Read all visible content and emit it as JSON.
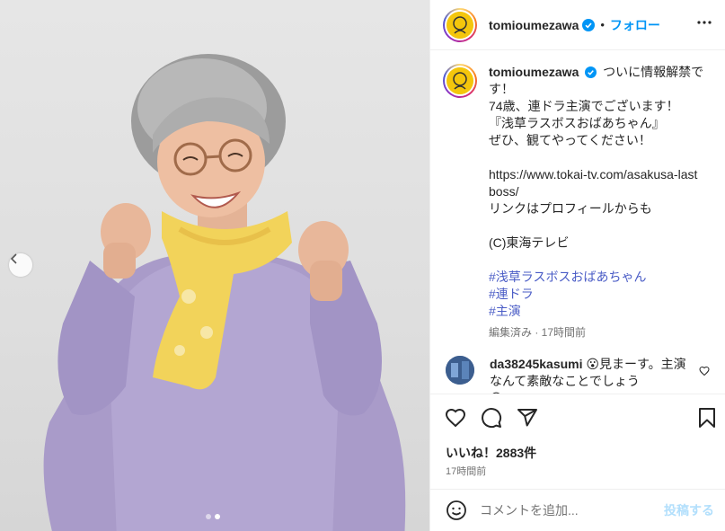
{
  "post": {
    "username": "tomioumezawa",
    "separator": "•",
    "follow_label": "フォロー",
    "more_icon": "more-horizontal-icon",
    "verified_icon": "verified-badge-icon",
    "verified_color": "#0095f6"
  },
  "caption": {
    "username": "tomioumezawa",
    "lines": [
      "ついに情報解禁です！",
      "74歳、連ドラ主演でございます！",
      "『浅草ラスボスおばあちゃん』",
      "ぜひ、観てやってください！",
      "",
      "https://www.tokai-tv.com/asakusa-lastboss/",
      "リンクはプロフィールからも",
      "",
      "(C)東海テレビ",
      ""
    ],
    "hashtags": [
      "#浅草ラスボスおばあちゃん",
      "#連ドラ",
      "#主演"
    ],
    "meta": "編集済み · 17時間前"
  },
  "comments": [
    {
      "username": "da38245kasumi",
      "text": "😮見まーす。主演なんて素敵なことでしょう",
      "overflow_text": "😮 ……"
    }
  ],
  "actions": {
    "like_icon": "heart-icon",
    "comment_icon": "comment-icon",
    "share_icon": "share-icon",
    "save_icon": "bookmark-icon",
    "likes_text": "いいね！2883件",
    "time_text": "17時間前"
  },
  "add_comment": {
    "placeholder": "コメントを追加...",
    "post_label": "投稿する",
    "emoji_icon": "emoji-icon"
  },
  "carousel": {
    "count": 2,
    "active_index": 1,
    "prev_icon": "chevron-left-icon"
  },
  "colors": {
    "accent": "#0095f6",
    "hashtag": "#4a5cc6",
    "secondary_text": "#737373",
    "post_disabled": "#b2dffc"
  }
}
